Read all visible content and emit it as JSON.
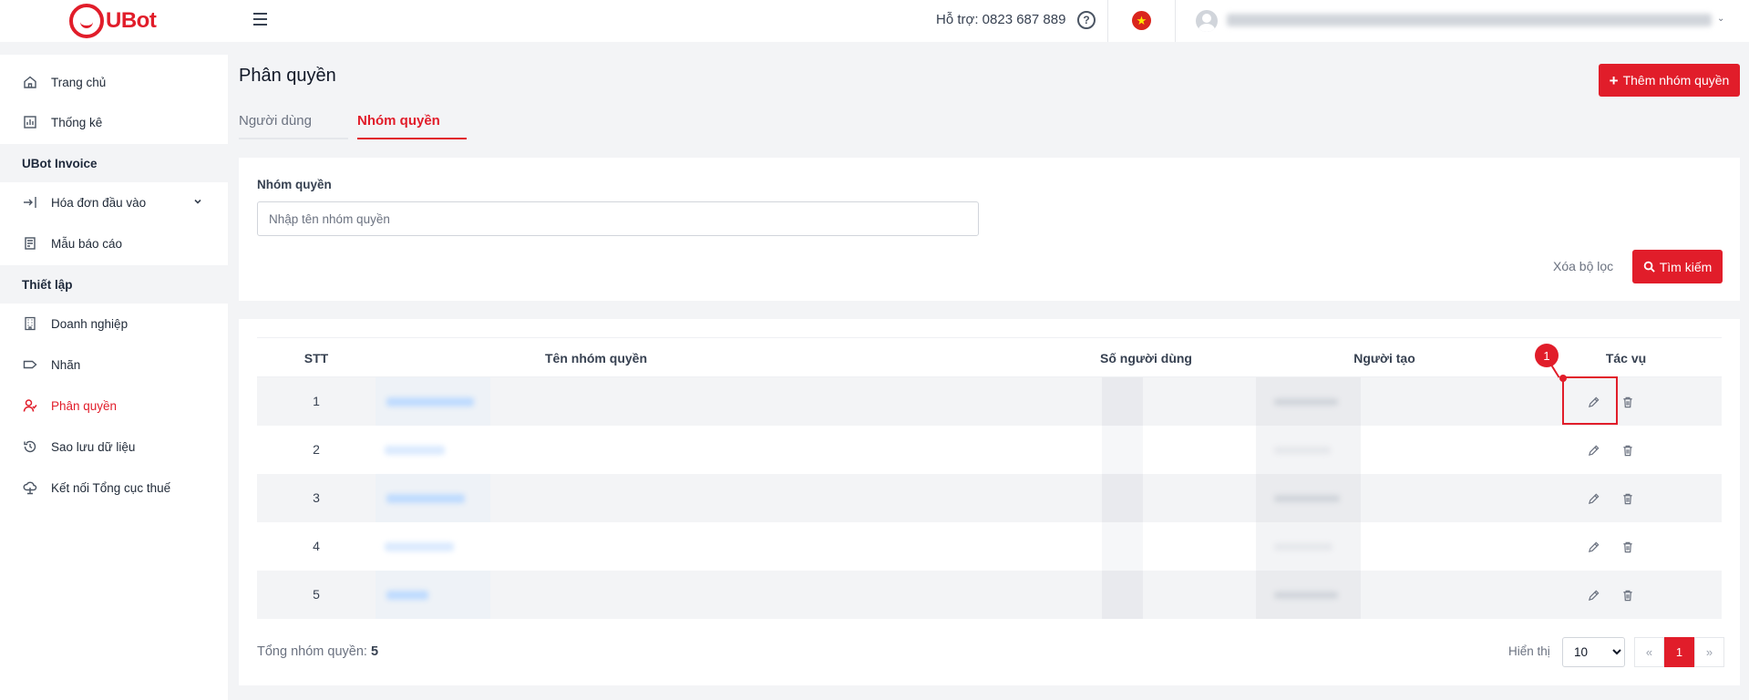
{
  "brand": {
    "name": "UBot"
  },
  "header": {
    "support_text": "Hỗ trợ: 0823 687 889",
    "help_glyph": "?",
    "flag_glyph": "★"
  },
  "sidebar": {
    "items": [
      {
        "label": "Trang chủ",
        "icon": "home-icon"
      },
      {
        "label": "Thống kê",
        "icon": "chart-icon"
      },
      {
        "label": "Hóa đơn đầu vào",
        "icon": "import-icon"
      },
      {
        "label": "Mẫu báo cáo",
        "icon": "report-icon"
      },
      {
        "label": "Doanh nghiệp",
        "icon": "building-icon"
      },
      {
        "label": "Nhãn",
        "icon": "tag-icon"
      },
      {
        "label": "Phân quyền",
        "icon": "user-permission-icon"
      },
      {
        "label": "Sao lưu dữ liệu",
        "icon": "history-icon"
      },
      {
        "label": "Kết nối Tổng cục thuế",
        "icon": "cloud-upload-icon"
      }
    ],
    "sections": [
      "UBot Invoice",
      "Thiết lập"
    ],
    "colors": {
      "active": "#e11d2a"
    }
  },
  "page": {
    "title": "Phân quyền",
    "add_button": "Thêm nhóm quyền",
    "tabs": [
      "Người dùng",
      "Nhóm quyền"
    ]
  },
  "filter": {
    "label": "Nhóm quyền",
    "placeholder": "Nhập tên nhóm quyền",
    "clear": "Xóa bộ lọc",
    "search": "Tìm kiếm"
  },
  "table": {
    "headers": [
      "STT",
      "Tên nhóm quyền",
      "Số người dùng",
      "Người tạo",
      "Tác vụ"
    ],
    "rows": [
      {
        "stt": "1"
      },
      {
        "stt": "2"
      },
      {
        "stt": "3"
      },
      {
        "stt": "4"
      },
      {
        "stt": "5"
      }
    ]
  },
  "annotation": {
    "badge": "1"
  },
  "footer": {
    "total_label": "Tổng nhóm quyền:",
    "total_value": "5",
    "show_label": "Hiển thị",
    "page_size": "10",
    "prev": "«",
    "current_page": "1",
    "next": "»"
  },
  "colors": {
    "accent": "#e11d2a",
    "link_blur": "#bfdbfe"
  }
}
